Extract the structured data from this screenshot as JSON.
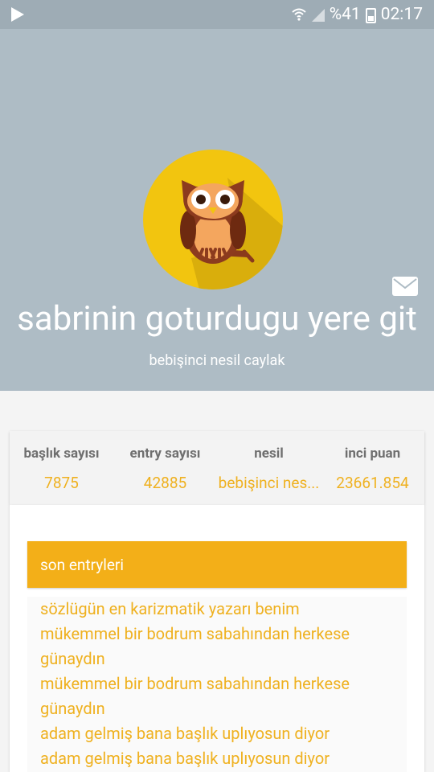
{
  "status_bar": {
    "battery": "%41",
    "time": "02:17"
  },
  "profile": {
    "username": "sabrinin goturdugu yere git",
    "title": "bebişinci nesil caylak"
  },
  "stats": [
    {
      "label": "başlık sayısı",
      "value": "7875"
    },
    {
      "label": "entry sayısı",
      "value": "42885"
    },
    {
      "label": "nesil",
      "value": "bebişinci nes..."
    },
    {
      "label": "inci puan",
      "value": "23661.854"
    }
  ],
  "entries": {
    "header": "son entryleri",
    "items": [
      "sözlügün en karizmatik yazarı benim",
      "mükemmel bir bodrum sabahından herkese günaydın",
      "mükemmel bir bodrum sabahından herkese günaydın",
      "adam gelmiş bana başlık uplıyosun diyor",
      "adam gelmiş bana başlık uplıyosun diyor"
    ]
  },
  "colors": {
    "header_bg": "#aebcc5",
    "accent": "#f3af18",
    "entry_text": "#efb120"
  }
}
